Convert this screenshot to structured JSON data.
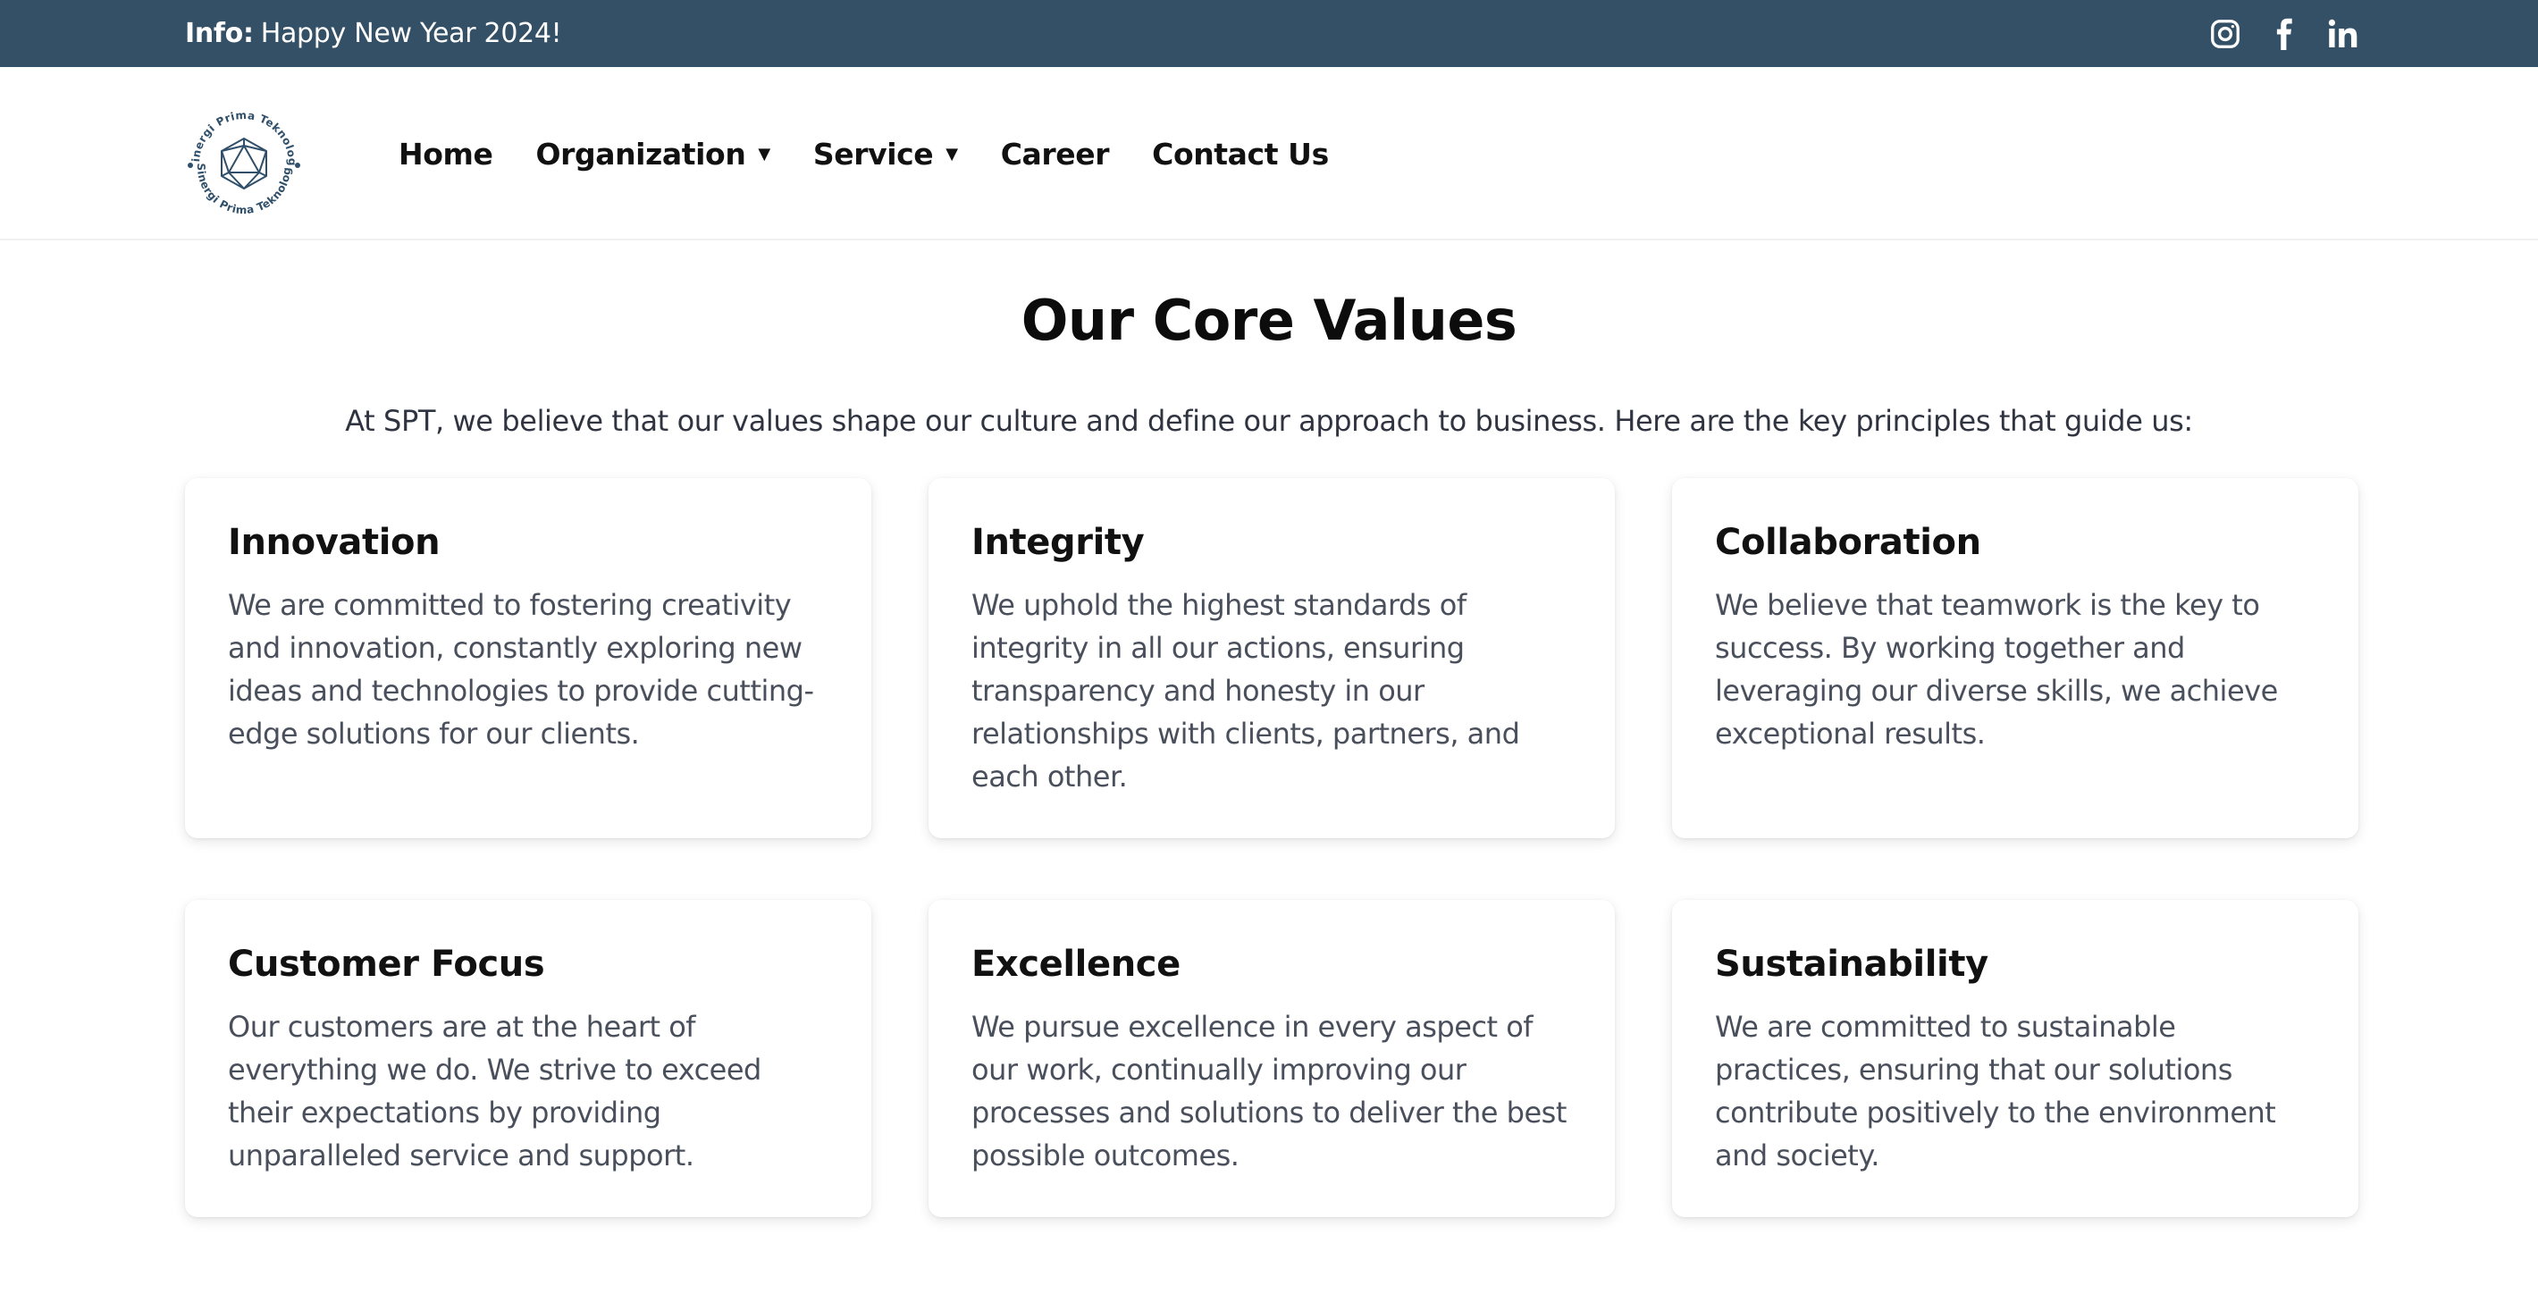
{
  "topbar": {
    "info_label": "Info:",
    "info_text": "Happy New Year 2024!",
    "social": [
      "instagram-icon",
      "facebook-icon",
      "linkedin-icon"
    ],
    "background": "#335066"
  },
  "header": {
    "logo": {
      "text_top": "Sinergi Prima Teknologi",
      "text_bottom": "Sinergi Prima Teknologi",
      "color": "#2f4f6a"
    },
    "nav": [
      {
        "label": "Home"
      },
      {
        "label": "Organization",
        "has_dropdown": true
      },
      {
        "label": "Service",
        "has_dropdown": true
      },
      {
        "label": "Career"
      },
      {
        "label": "Contact Us"
      }
    ]
  },
  "main": {
    "title": "Our Core Values",
    "intro": "At SPT, we believe that our values shape our culture and define our approach to business. Here are the key principles that guide us:",
    "values": [
      {
        "title": "Innovation",
        "text": "We are committed to fostering creativity and innovation, constantly exploring new ideas and technologies to provide cutting-edge solutions for our clients."
      },
      {
        "title": "Integrity",
        "text": "We uphold the highest standards of integrity in all our actions, ensuring transparency and honesty in our relationships with clients, partners, and each other."
      },
      {
        "title": "Collaboration",
        "text": "We believe that teamwork is the key to success. By working together and leveraging our diverse skills, we achieve exceptional results."
      },
      {
        "title": "Customer Focus",
        "text": "Our customers are at the heart of everything we do. We strive to exceed their expectations by providing unparalleled service and support."
      },
      {
        "title": "Excellence",
        "text": "We pursue excellence in every aspect of our work, continually improving our processes and solutions to deliver the best possible outcomes."
      },
      {
        "title": "Sustainability",
        "text": "We are committed to sustainable practices, ensuring that our solutions contribute positively to the environment and society."
      }
    ]
  }
}
